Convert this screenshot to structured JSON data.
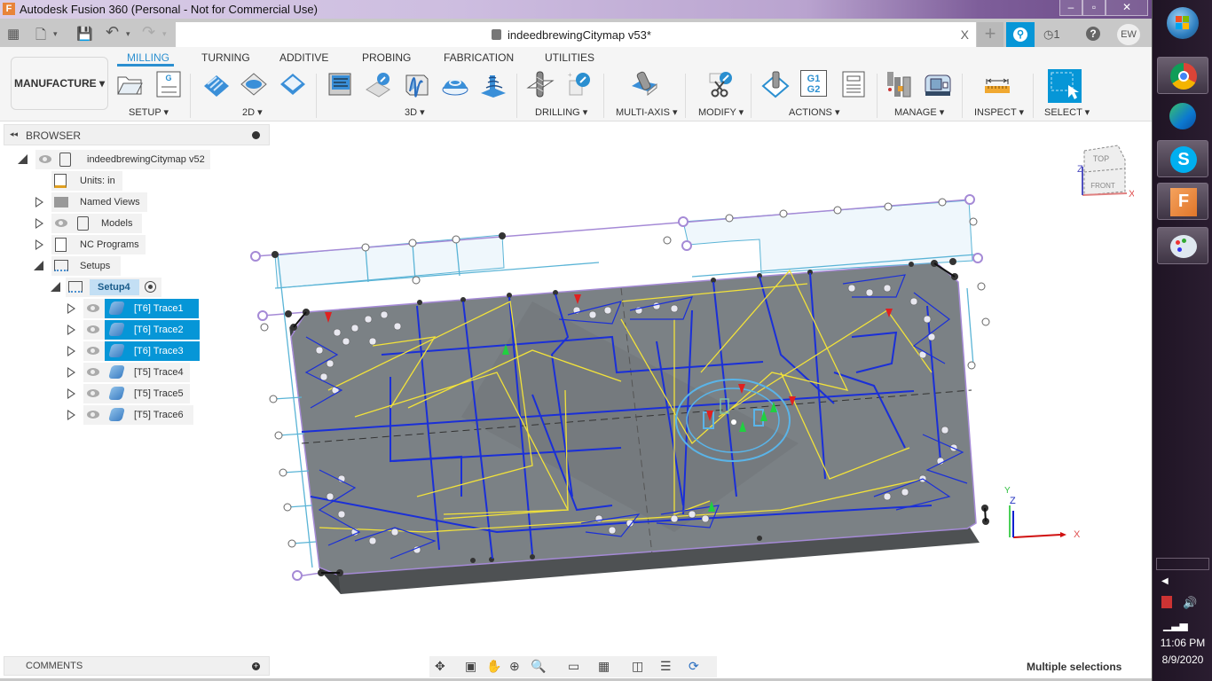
{
  "window": {
    "title": "Autodesk Fusion 360 (Personal - Not for Commercial Use)",
    "app_icon": "F",
    "controls": {
      "minimize": "–",
      "maximize": "▫",
      "close": "✕"
    }
  },
  "quick_access": {
    "grid_icon": "▦",
    "file_icon": "🗋",
    "save_icon": "💾",
    "undo_icon": "↶",
    "redo_icon": "↷",
    "caret": "▾"
  },
  "document_tab": {
    "name": "indeedbrewingCitymap v53*",
    "close": "X"
  },
  "header_right": {
    "new_tab": "+",
    "job_status_icon": "⚲",
    "notifications_count": "◷1",
    "help": "?",
    "user_initials": "EW"
  },
  "ribbon": {
    "workspace": "MANUFACTURE ▾",
    "tabs": [
      {
        "label": "MILLING",
        "active": true
      },
      {
        "label": "TURNING",
        "active": false
      },
      {
        "label": "ADDITIVE",
        "active": false
      },
      {
        "label": "PROBING",
        "active": false
      },
      {
        "label": "FABRICATION",
        "active": false
      },
      {
        "label": "UTILITIES",
        "active": false
      }
    ],
    "groups": [
      {
        "label": "SETUP ▾"
      },
      {
        "label": "2D ▾"
      },
      {
        "label": "3D ▾"
      },
      {
        "label": "DRILLING ▾"
      },
      {
        "label": "MULTI-AXIS ▾"
      },
      {
        "label": "MODIFY ▾"
      },
      {
        "label": "ACTIONS ▾"
      },
      {
        "label": "MANAGE ▾"
      },
      {
        "label": "INSPECT ▾"
      },
      {
        "label": "SELECT ▾"
      }
    ],
    "actions_g_label": "G1\nG2",
    "nc_g_label": "G"
  },
  "browser": {
    "title": "BROWSER",
    "collapse": "◂◂",
    "items": [
      {
        "label": "indeedbrewingCitymap v52",
        "level": 0,
        "expanded": true
      },
      {
        "label": "Units: in",
        "level": 1
      },
      {
        "label": "Named Views",
        "level": 1,
        "expanded": false
      },
      {
        "label": "Models",
        "level": 1,
        "expanded": false
      },
      {
        "label": "NC Programs",
        "level": 1,
        "expanded": false
      },
      {
        "label": "Setups",
        "level": 1,
        "expanded": true
      },
      {
        "label": "Setup4",
        "level": 2,
        "expanded": true
      },
      {
        "label": "[T6] Trace1",
        "level": 3,
        "selected": true
      },
      {
        "label": "[T6] Trace2",
        "level": 3,
        "selected": true
      },
      {
        "label": "[T6] Trace3",
        "level": 3,
        "selected": true
      },
      {
        "label": "[T5] Trace4",
        "level": 3,
        "selected": false
      },
      {
        "label": "[T5] Trace5",
        "level": 3,
        "selected": false
      },
      {
        "label": "[T5] Trace6",
        "level": 3,
        "selected": false
      }
    ]
  },
  "viewcube": {
    "top": "TOP",
    "front": "FRONT",
    "x": "X",
    "z": "Z"
  },
  "triad": {
    "x": "X",
    "y": "Y",
    "z": "Z"
  },
  "comments": {
    "title": "COMMENTS"
  },
  "navbar": {
    "orbit": "✥",
    "look_at": "▣",
    "pan": "✋",
    "zoom": "⊕",
    "fit": "🔍",
    "display": "▭",
    "grid": "▦",
    "viewports": "◫",
    "effects": "☰",
    "sync": "⟳"
  },
  "status": {
    "text": "Multiple selections"
  },
  "colors": {
    "accent": "#0696d7",
    "toolpath_yellow": "#f2e23a",
    "toolpath_blue": "#1a2fd8",
    "stock": "#7b8185",
    "boundary": "#a58ad6"
  },
  "taskbar": {
    "apps": [
      {
        "name": "start"
      },
      {
        "name": "chrome"
      },
      {
        "name": "edge"
      },
      {
        "name": "skype"
      },
      {
        "name": "fusion360"
      },
      {
        "name": "paint"
      }
    ],
    "time": "11:06 PM",
    "date": "8/9/2020"
  }
}
